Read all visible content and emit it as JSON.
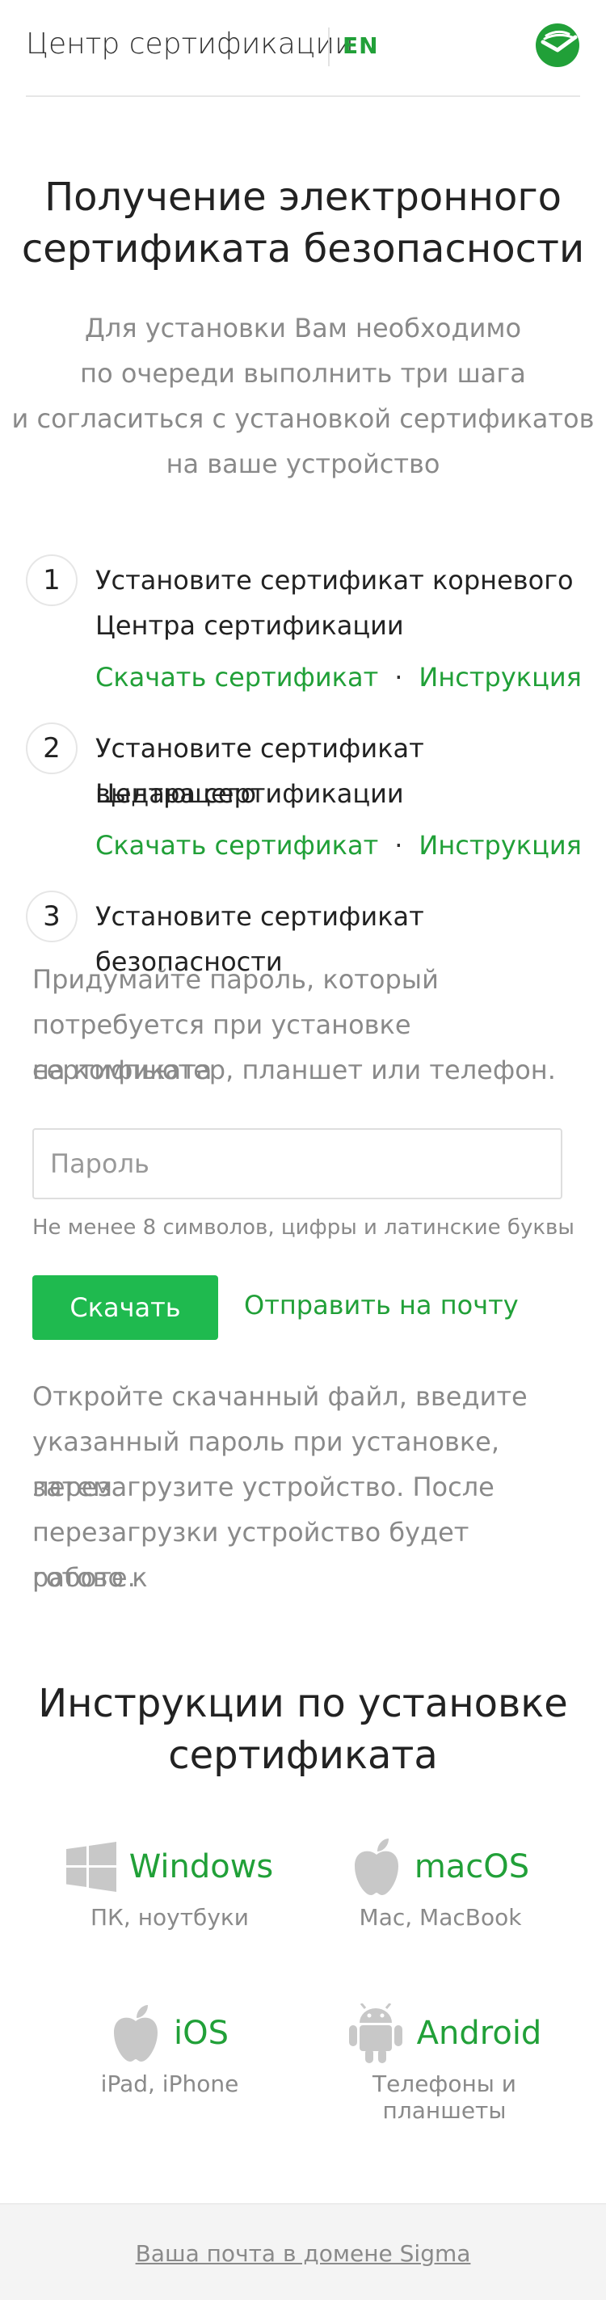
{
  "header": {
    "brand": "Центр сертификации",
    "lang": "EN",
    "logo_icon": "sber-logo-icon",
    "accent": "#21a038"
  },
  "main": {
    "title_line1": "Получение электронного",
    "title_line2": "сертификата безопасности",
    "subtitle_lines": [
      "Для установки Вам необходимо",
      "по очереди выполнить три шага",
      "и согласиться с установкой сертификатов",
      "на ваше устройство"
    ]
  },
  "steps": [
    {
      "num": "1",
      "line1": "Установите сертификат корневого",
      "line2": "Центра сертификации",
      "download": "Скачать сертификат",
      "instruction": "Инструкция"
    },
    {
      "num": "2",
      "line1": "Установите сертификат выдающего",
      "line2": "Центра сертификации",
      "download": "Скачать сертификат",
      "instruction": "Инструкция"
    },
    {
      "num": "3",
      "line1": "Установите сертификат безопасности"
    }
  ],
  "step_links_separator": "·",
  "password": {
    "intro_lines": [
      "Придумайте пароль, который",
      "потребуется при установке сертификата",
      "на компьютер, планшет или телефон."
    ],
    "placeholder": "Пароль",
    "value": "",
    "hint": "Не менее 8 символов, цифры и латинские буквы",
    "download_button": "Скачать",
    "send_link": "Отправить на почту"
  },
  "after_lines": [
    "Откройте скачанный файл, введите",
    "указанный пароль при установке, затем",
    "перезагрузите устройство. После",
    "перезагрузки устройство будет готово к",
    "работе."
  ],
  "instructions": {
    "title_line1": "Инструкции по установке",
    "title_line2": "сертификата",
    "os": [
      {
        "name": "Windows",
        "sub": "ПК, ноутбуки",
        "icon": "windows-icon"
      },
      {
        "name": "macOS",
        "sub": "Mac, MacBook",
        "icon": "apple-icon"
      },
      {
        "name": "iOS",
        "sub": "iPad, iPhone",
        "icon": "apple-icon"
      },
      {
        "name": "Android",
        "sub": "Телефоны и планшеты",
        "icon": "android-icon"
      }
    ]
  },
  "footer": {
    "link": "Ваша почта в домене Sigma"
  }
}
